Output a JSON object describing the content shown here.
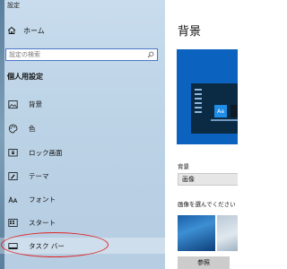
{
  "app_title": "設定",
  "sidebar": {
    "home_label": "ホーム",
    "search_placeholder": "設定の検索",
    "section_heading": "個人用設定",
    "items": [
      {
        "label": "背景",
        "icon": "picture-icon"
      },
      {
        "label": "色",
        "icon": "palette-icon"
      },
      {
        "label": "ロック画面",
        "icon": "lock-screen-icon"
      },
      {
        "label": "テーマ",
        "icon": "theme-icon"
      },
      {
        "label": "フォント",
        "icon": "font-icon"
      },
      {
        "label": "スタート",
        "icon": "start-icon"
      },
      {
        "label": "タスク バー",
        "icon": "taskbar-icon"
      }
    ]
  },
  "main": {
    "title": "背景",
    "preview_tile_text": "Aa",
    "background_label": "背景",
    "background_value": "画像",
    "choose_image_label": "画像を選んでください",
    "browse_button": "参照"
  },
  "colors": {
    "sidebar_bg": "#c8dced",
    "accent": "#0b63bf",
    "annotation": "#e02424"
  }
}
